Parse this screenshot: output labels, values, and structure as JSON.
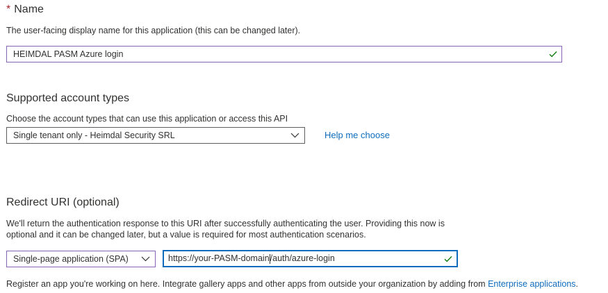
{
  "name_section": {
    "required_marker": "*",
    "title": "Name",
    "description": "The user-facing display name for this application (this can be changed later).",
    "value": "HEIMDAL PASM Azure login",
    "valid_icon": "checkmark-icon"
  },
  "account_types": {
    "title": "Supported account types",
    "description": "Choose the account types that can use this application or access this API",
    "selected": "Single tenant only - Heimdal Security SRL",
    "help_link": "Help me choose",
    "dropdown_icon": "chevron-down-icon"
  },
  "redirect_uri": {
    "title": "Redirect URI (optional)",
    "description_line1": "We'll return the authentication response to this URI after successfully authenticating the user. Providing this now is",
    "description_line2": "optional and it can be changed later, but a value is required for most authentication scenarios.",
    "platform_selected": "Single-page application (SPA)",
    "uri_before_caret": "https://your-PASM-domain",
    "uri_after_caret": "/auth/azure-login",
    "valid_icon": "checkmark-icon"
  },
  "footer": {
    "text": "Register an app you're working on here. Integrate gallery apps and other apps from outside your organization by adding from ",
    "link": "Enterprise applications",
    "trailing": "."
  },
  "colors": {
    "accent": "#0f6cbd",
    "valid": "#107c10",
    "required": "#a4262c",
    "field_border_valid": "#8764b8"
  }
}
